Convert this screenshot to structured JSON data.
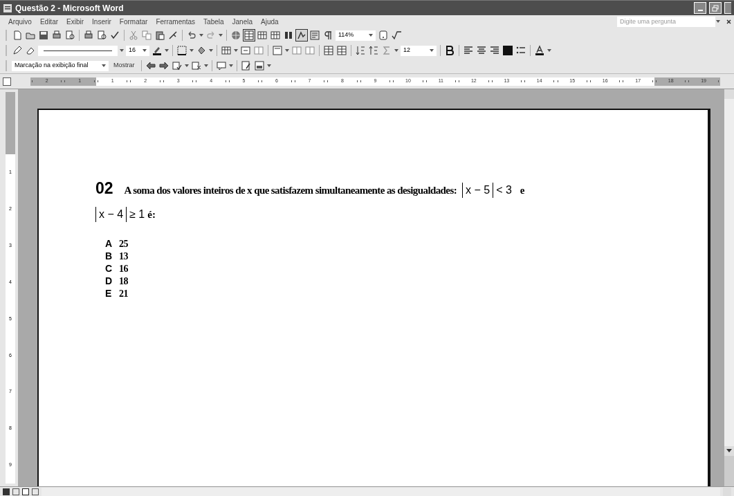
{
  "window": {
    "title": "Questão 2 - Microsoft Word"
  },
  "menu": [
    "Arquivo",
    "Editar",
    "Exibir",
    "Inserir",
    "Formatar",
    "Ferramentas",
    "Tabela",
    "Janela",
    "Ajuda"
  ],
  "help_box": {
    "placeholder": "Digite uma pergunta"
  },
  "standard_toolbar": {
    "zoom": "114%"
  },
  "formatting_toolbar": {
    "line_size": "16",
    "font_size": "12"
  },
  "review_toolbar": {
    "display": "Marcação na exibição final",
    "show": "Mostrar"
  },
  "ruler": {
    "left_labels": [
      "2",
      "1"
    ],
    "labels": [
      "1",
      "2",
      "3",
      "4",
      "5",
      "6",
      "7",
      "8",
      "9",
      "10",
      "11",
      "12",
      "13",
      "14",
      "15",
      "16",
      "17"
    ],
    "right_labels": [
      "18",
      "19"
    ]
  },
  "vertical_ruler": {
    "labels": [
      "1",
      "2",
      "3",
      "4",
      "5",
      "6",
      "7",
      "8",
      "9"
    ]
  },
  "question": {
    "number": "02",
    "text": "A soma dos valores inteiros de x que satisfazem simultaneamente as desigualdades:",
    "math_1": "x − 5",
    "relation_1": "< 3",
    "conjunction": "e",
    "math_2": "x − 4",
    "relation_2": "≥ 1",
    "ending": "é:"
  },
  "options": [
    {
      "letter": "A",
      "value": "25"
    },
    {
      "letter": "B",
      "value": "13"
    },
    {
      "letter": "C",
      "value": "16"
    },
    {
      "letter": "D",
      "value": "18"
    },
    {
      "letter": "E",
      "value": "21"
    }
  ]
}
